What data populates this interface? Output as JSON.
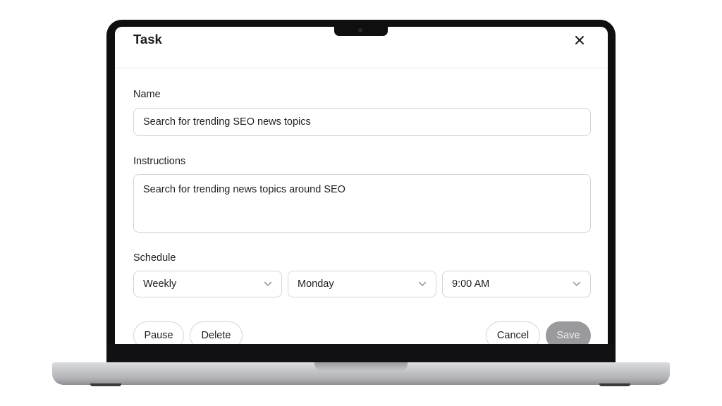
{
  "dialog": {
    "title": "Task",
    "close_icon": "close-icon"
  },
  "form": {
    "name_label": "Name",
    "name_value": "Search for trending SEO news topics",
    "instructions_label": "Instructions",
    "instructions_value": "Search for trending news topics around SEO",
    "schedule_label": "Schedule",
    "schedule": {
      "frequency": "Weekly",
      "day": "Monday",
      "time": "9:00 AM"
    }
  },
  "actions": {
    "pause": "Pause",
    "delete": "Delete",
    "cancel": "Cancel",
    "save": "Save"
  },
  "colors": {
    "save_disabled_bg": "#9a9a9d",
    "bezel": "#0f0f10"
  }
}
